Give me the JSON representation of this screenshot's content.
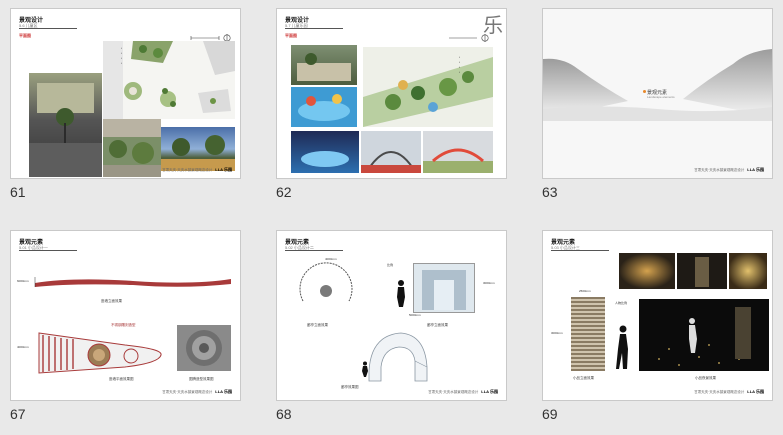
{
  "slides": [
    {
      "number": "61",
      "title": "景观设计",
      "subtitle": "5.6 儿童区",
      "section": "平面图",
      "legend": [
        "•",
        "•",
        "•",
        "•"
      ],
      "footer": "甘肃天庆·天庆水镇景观概念设计",
      "footer_logo": "LLA 乐园"
    },
    {
      "number": "62",
      "title": "景观设计",
      "subtitle": "5.7 儿童乐园",
      "section": "平面图",
      "big_char": "乐",
      "legend": [
        "•",
        "•",
        "•",
        "•"
      ]
    },
    {
      "number": "63",
      "title": "景观元素",
      "subtitle": "Landscape elements",
      "footer": "甘肃天庆·天庆水镇景观概念设计",
      "footer_logo": "LLA 乐园"
    },
    {
      "number": "67",
      "title": "景观元素",
      "subtitle": "5.01 小品设计一",
      "dim_top": "6000mm",
      "dim_side": "4000mm",
      "callout": "不锈钢雕刻造型",
      "captions": [
        "座墙立面效果",
        "座墙平面效果图",
        "图腾造型效果图"
      ],
      "footer": "甘肃天庆·天庆水镇景观概念设计",
      "footer_logo": "LLA 乐园"
    },
    {
      "number": "68",
      "title": "景观元素",
      "subtitle": "5.02 小品设计二",
      "dim_top": "4000mm",
      "dim_right": "3000mm",
      "dim_mid": "5000mm",
      "figure_label": "比例",
      "captions": [
        "廊亭立面效果",
        "廊亭立面效果",
        "廊亭效果图"
      ],
      "footer": "甘肃天庆·天庆水镇景观概念设计",
      "footer_logo": "LLA 乐园"
    },
    {
      "number": "69",
      "title": "景观元素",
      "subtitle": "5.03 小品设计三",
      "dim_top": "2500mm",
      "dim_side": "3000mm",
      "figure_label": "人物比例",
      "captions": [
        "小品立面效果",
        "小品夜景效果"
      ],
      "footer": "甘肃天庆·天庆水镇景观概念设计",
      "footer_logo": "LLA 乐园"
    }
  ]
}
